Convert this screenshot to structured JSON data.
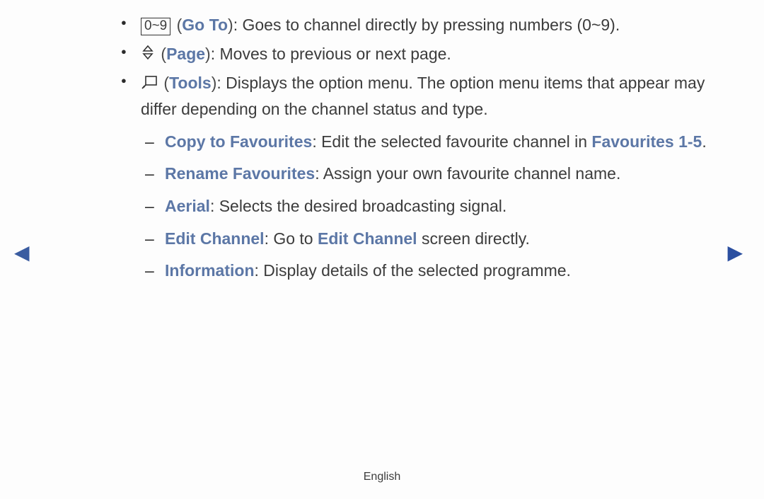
{
  "items": [
    {
      "icon_text": "0~9",
      "label_open": "(",
      "label": "Go To",
      "label_close": ")",
      "desc": ": Goes to channel directly by pressing numbers (0~9)."
    },
    {
      "label_open": "(",
      "label": "Page",
      "label_close": ")",
      "desc": ": Moves to previous or next page."
    },
    {
      "label_open": "(",
      "label": "Tools",
      "label_close": ")",
      "desc": ": Displays the option menu. The option menu items that appear may differ depending on the channel status and type.",
      "sub": [
        {
          "label": "Copy to Favourites",
          "desc_a": ": Edit the selected favourite channel in ",
          "link": "Favourites 1-5",
          "desc_b": "."
        },
        {
          "label": "Rename Favourites",
          "desc": ": Assign your own favourite channel name."
        },
        {
          "label": "Aerial",
          "desc": ": Selects the desired broadcasting signal."
        },
        {
          "label": "Edit Channel",
          "desc_a": ": Go to ",
          "link": "Edit Channel",
          "desc_b": " screen directly."
        },
        {
          "label": "Information",
          "desc": ": Display details of the selected programme."
        }
      ]
    }
  ],
  "footer": "English",
  "nav": {
    "prev": "◀",
    "next": "▶"
  }
}
